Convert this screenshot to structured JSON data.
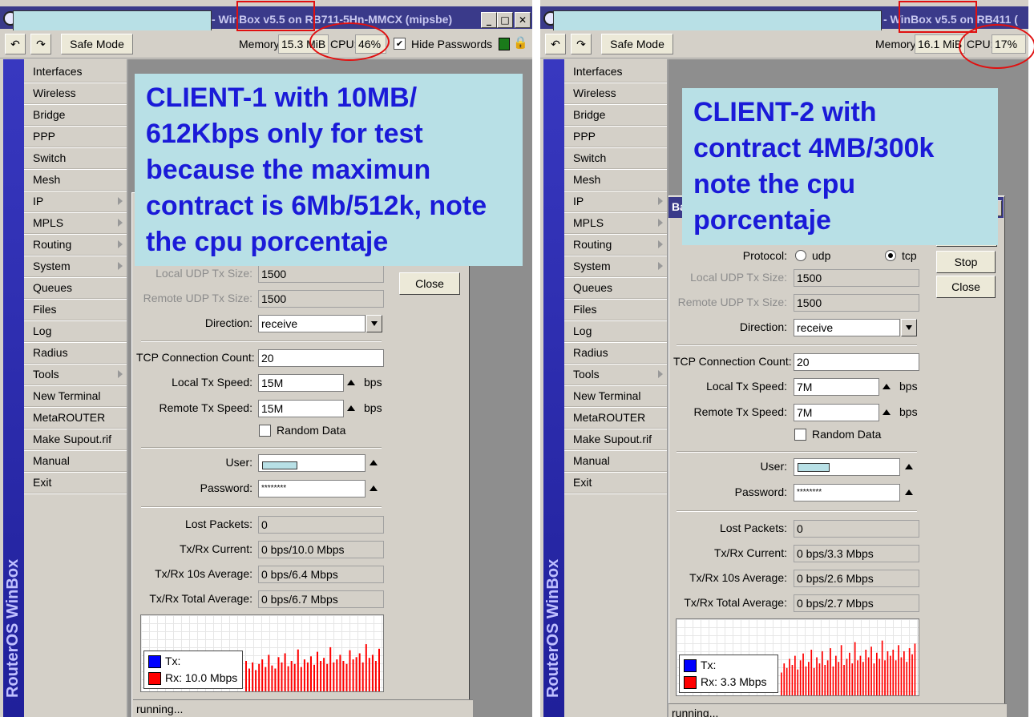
{
  "left_window": {
    "title": "- WinBox v5.5 on RB711-5Hn-MMCX (mipsbe)",
    "toolbar": {
      "undo_icon": "undo-icon",
      "redo_icon": "redo-icon",
      "safe_mode": "Safe Mode",
      "memory_label": "Memory:",
      "memory_value": "15.3 MiB",
      "cpu_label": "CPU:",
      "cpu_value": "46%",
      "hide_passwords": "Hide Passwords"
    },
    "sidebar_brand": "RouterOS WinBox",
    "menu": [
      "Interfaces",
      "Wireless",
      "Bridge",
      "PPP",
      "Switch",
      "Mesh",
      "IP",
      "MPLS",
      "Routing",
      "System",
      "Queues",
      "Files",
      "Log",
      "Radius",
      "Tools",
      "New Terminal",
      "MetaROUTER",
      "Make Supout.rif",
      "Manual",
      "Exit"
    ],
    "callout": "CLIENT-1 with 10MB/ 612Kbps only for test because the maximun contract is 6Mb/512k, note the cpu porcentaje",
    "form": {
      "local_udp_label": "Local UDP Tx Size:",
      "local_udp_value": "1500",
      "remote_udp_label": "Remote UDP Tx Size:",
      "remote_udp_value": "1500",
      "direction_label": "Direction:",
      "direction_value": "receive",
      "tcp_count_label": "TCP Connection Count:",
      "tcp_count_value": "20",
      "local_tx_label": "Local Tx Speed:",
      "local_tx_value": "15M",
      "remote_tx_label": "Remote Tx Speed:",
      "remote_tx_value": "15M",
      "bps": "bps",
      "random_data": "Random Data",
      "user_label": "User:",
      "user_value": "",
      "password_label": "Password:",
      "password_value": "********",
      "lost_label": "Lost Packets:",
      "lost_value": "0",
      "current_label": "Tx/Rx Current:",
      "current_value": "0 bps/10.0 Mbps",
      "avg10_label": "Tx/Rx 10s Average:",
      "avg10_value": "0 bps/6.4 Mbps",
      "total_label": "Tx/Rx Total Average:",
      "total_value": "0 bps/6.7 Mbps"
    },
    "close_button": "Close",
    "legend_tx": "Tx:",
    "legend_rx": "Rx:  10.0 Mbps",
    "status": "running...",
    "graph_rx_levels": [
      0.4,
      0.3,
      0.38,
      0.28,
      0.36,
      0.42,
      0.32,
      0.48,
      0.34,
      0.3,
      0.45,
      0.38,
      0.5,
      0.33,
      0.4,
      0.36,
      0.55,
      0.32,
      0.42,
      0.38,
      0.46,
      0.35,
      0.52,
      0.4,
      0.44,
      0.36,
      0.58,
      0.38,
      0.42,
      0.48,
      0.4,
      0.36,
      0.54,
      0.42,
      0.45,
      0.5,
      0.38,
      0.62,
      0.44,
      0.48,
      0.4,
      0.56
    ]
  },
  "right_window": {
    "title": "- WinBox v5.5 on RB411 (",
    "toolbar": {
      "undo_icon": "undo-icon",
      "redo_icon": "redo-icon",
      "safe_mode": "Safe Mode",
      "memory_label": "Memory:",
      "memory_value": "16.1 MiB",
      "cpu_label": "CPU:",
      "cpu_value": "17%"
    },
    "sidebar_brand": "RouterOS WinBox",
    "menu": [
      "Interfaces",
      "Wireless",
      "Bridge",
      "PPP",
      "Switch",
      "Mesh",
      "IP",
      "MPLS",
      "Routing",
      "System",
      "Queues",
      "Files",
      "Log",
      "Radius",
      "Tools",
      "New Terminal",
      "MetaROUTER",
      "Make Supout.rif",
      "Manual",
      "Exit"
    ],
    "dialog_title_fragment": "Ba",
    "callout": "CLIENT-2 with contract 4MB/300k note the cpu porcentaje",
    "form": {
      "protocol_label": "Protocol:",
      "udp": "udp",
      "tcp": "tcp",
      "protocol_selected": "tcp",
      "local_udp_label": "Local UDP Tx Size:",
      "local_udp_value": "1500",
      "remote_udp_label": "Remote UDP Tx Size:",
      "remote_udp_value": "1500",
      "direction_label": "Direction:",
      "direction_value": "receive",
      "tcp_count_label": "TCP Connection Count:",
      "tcp_count_value": "20",
      "local_tx_label": "Local Tx Speed:",
      "local_tx_value": "7M",
      "remote_tx_label": "Remote Tx Speed:",
      "remote_tx_value": "7M",
      "bps": "bps",
      "random_data": "Random Data",
      "user_label": "User:",
      "user_value": "",
      "password_label": "Password:",
      "password_value": "********",
      "lost_label": "Lost Packets:",
      "lost_value": "0",
      "current_label": "Tx/Rx Current:",
      "current_value": "0 bps/3.3 Mbps",
      "avg10_label": "Tx/Rx 10s Average:",
      "avg10_value": "0 bps/2.6 Mbps",
      "total_label": "Tx/Rx Total Average:",
      "total_value": "0 bps/2.7 Mbps"
    },
    "stop_button": "Stop",
    "close_button": "Close",
    "legend_tx": "Tx:",
    "legend_rx": "Rx:  3.3 Mbps",
    "status": "running...",
    "graph_rx_levels": [
      0.3,
      0.42,
      0.36,
      0.48,
      0.4,
      0.52,
      0.34,
      0.46,
      0.55,
      0.38,
      0.44,
      0.6,
      0.36,
      0.5,
      0.42,
      0.58,
      0.4,
      0.46,
      0.62,
      0.38,
      0.52,
      0.44,
      0.66,
      0.4,
      0.48,
      0.56,
      0.42,
      0.7,
      0.46,
      0.52,
      0.44,
      0.6,
      0.5,
      0.64,
      0.42,
      0.56,
      0.48,
      0.72,
      0.46,
      0.58,
      0.52,
      0.6,
      0.46,
      0.66,
      0.5,
      0.58,
      0.44,
      0.62,
      0.54,
      0.68
    ]
  },
  "colors": {
    "callout_bg": "#b8e0e6",
    "callout_text": "#1a1ad8",
    "annotation_red": "#e01010",
    "tx": "#0000ff",
    "rx": "#ff0000"
  }
}
